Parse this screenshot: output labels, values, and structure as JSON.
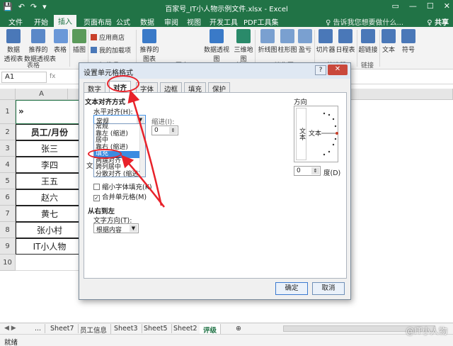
{
  "window": {
    "title": "百家号_IT小人物示例文件.xlsx - Excel",
    "qat": [
      "💾",
      "↶",
      "↷",
      "▾"
    ],
    "controls": [
      "▭",
      "—",
      "☐",
      "✕"
    ]
  },
  "ribbon_tabs": [
    "文件",
    "开始",
    "插入",
    "页面布局",
    "公式",
    "数据",
    "审阅",
    "视图",
    "开发工具",
    "PDF工具集"
  ],
  "active_tab": "插入",
  "tellme": "♀ 告诉我您想要做什么...",
  "share": "♀ 共享",
  "ribbon": {
    "buttons": [
      {
        "label": "数据\n透视表",
        "color": "#4a78b8"
      },
      {
        "label": "推荐的\n数据透视表",
        "color": "#4a78b8"
      },
      {
        "label": "表格",
        "color": "#4a78b8"
      },
      {
        "label": "插图",
        "color": "#5a9a5a"
      },
      {
        "label": "推荐的\n图表",
        "color": "#3a7ac8"
      },
      {
        "label": "数据透视图",
        "color": "#3a7ac8"
      },
      {
        "label": "三维地\n图",
        "color": "#3a7ac8"
      },
      {
        "label": "折线图",
        "color": "#3a7ac8"
      },
      {
        "label": "柱形图",
        "color": "#3a7ac8"
      },
      {
        "label": "盈亏",
        "color": "#3a7ac8"
      },
      {
        "label": "切片器",
        "color": "#3a7ac8"
      },
      {
        "label": "日程表",
        "color": "#3a7ac8"
      },
      {
        "label": "超链接",
        "color": "#3a7ac8"
      },
      {
        "label": "文本",
        "color": "#3a7ac8"
      },
      {
        "label": "符号",
        "color": "#3a7ac8"
      }
    ],
    "store": "应用商店",
    "addins": "我的加载项",
    "groups": [
      "表格",
      "加载项",
      "图表",
      "演示",
      "迷你图",
      "筛选器",
      "链接"
    ]
  },
  "formula_bar": {
    "name_box": "A1",
    "fx": "fx"
  },
  "sheet": {
    "col_header": "A",
    "row1": "»",
    "rows": [
      "员工/月份",
      "张三",
      "李四",
      "王五",
      "赵六",
      "黄七",
      "张小村",
      "IT小人物"
    ],
    "row_numbers": [
      "1",
      "2",
      "3",
      "4",
      "5",
      "6",
      "7",
      "8",
      "9",
      "10"
    ]
  },
  "sheet_tabs": [
    "...",
    "Sheet7",
    "员工信息",
    "Sheet3",
    "Sheet5",
    "Sheet2",
    "评级",
    "⊕"
  ],
  "active_sheet": "评级",
  "status": "就绪",
  "dialog": {
    "title": "设置单元格格式",
    "help": "?",
    "close": "✕",
    "tabs": [
      "数字",
      "对齐",
      "字体",
      "边框",
      "填充",
      "保护"
    ],
    "active_tab": "对齐",
    "text_align_section": "文本对齐方式",
    "horizontal_label": "水平对齐(H):",
    "horizontal_value": "常规",
    "indent_label": "缩进(I):",
    "indent_value": "0",
    "list_options": [
      "常规",
      "靠左 (缩进)",
      "居中",
      "靠右 (缩进)",
      "填充",
      "两端对齐",
      "跨列居中",
      "分散对齐 (缩进)"
    ],
    "selected_option": "填充",
    "partial_label": "文",
    "shrink_label": "缩小字体填充(K)",
    "merge_label": "合并单元格(M)",
    "merge_checked": "✓",
    "rtl_section": "从右到左",
    "text_direction_label": "文字方向(T):",
    "text_direction_value": "根据内容",
    "orientation_label": "方向",
    "vertical_text": "文本",
    "horizontal_text": "文本",
    "degree_value": "0",
    "degree_label": "度(D)",
    "ok": "确定",
    "cancel": "取消"
  },
  "watermark": "@IT小人物",
  "colors": {
    "excel_green": "#217346",
    "selection_blue": "#3b8be0",
    "annotation_red": "#e8222a"
  }
}
